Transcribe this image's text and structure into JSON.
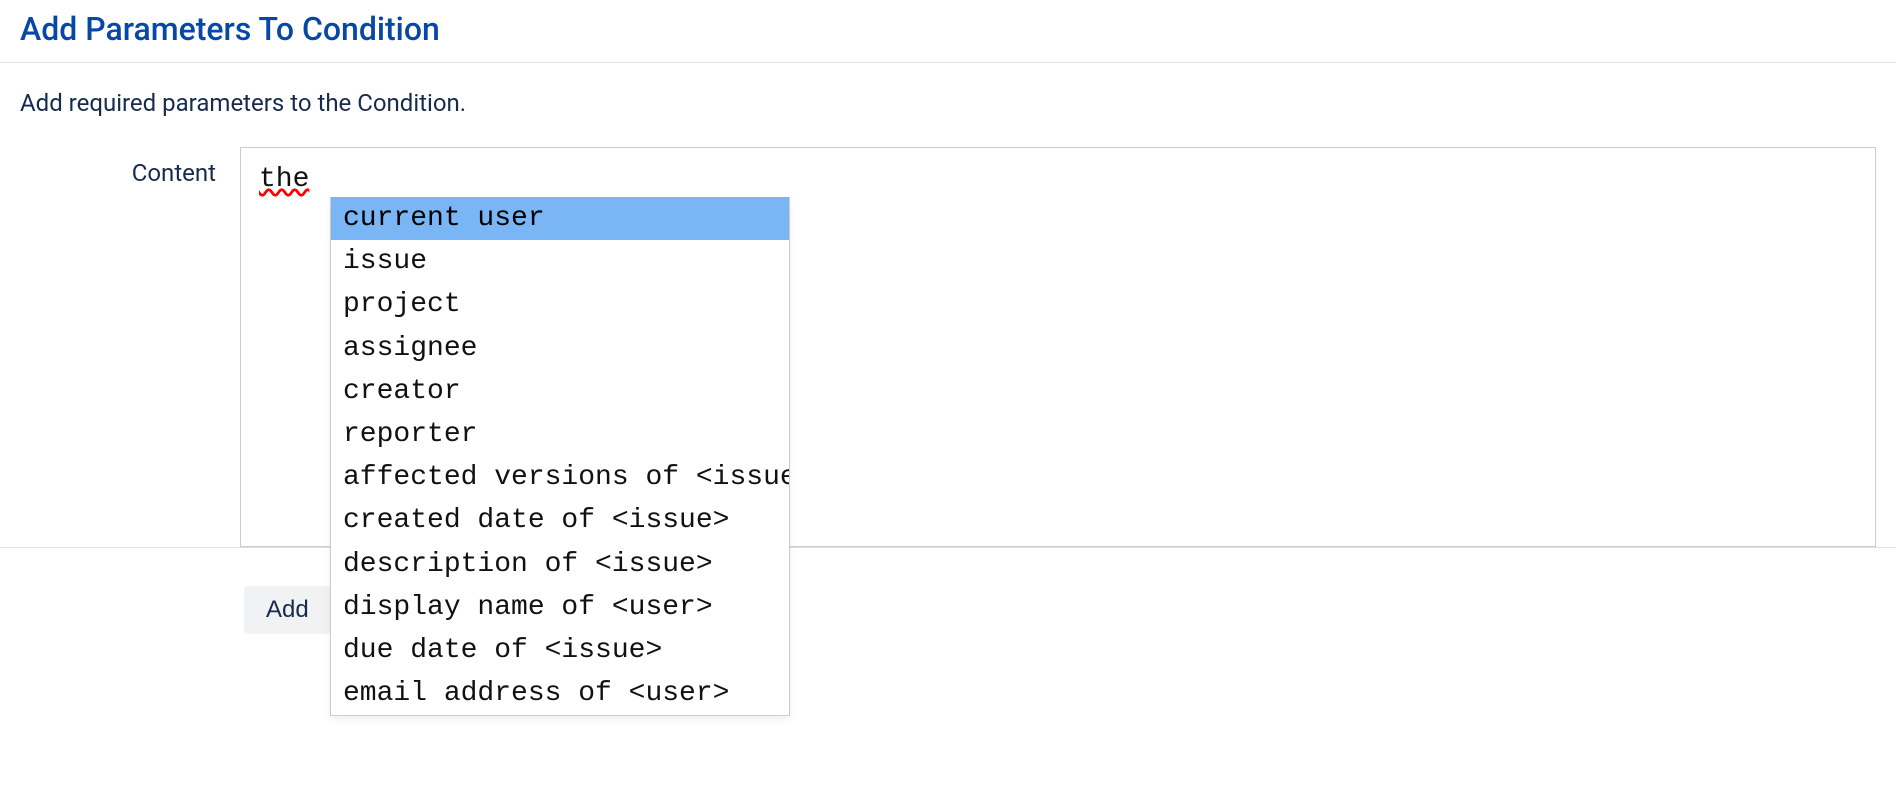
{
  "page": {
    "title": "Add Parameters To Condition",
    "description": "Add required parameters to the Condition."
  },
  "form": {
    "content_label": "Content",
    "content_value": "the",
    "add_button_label": "Add"
  },
  "autocomplete": {
    "highlighted_index": 0,
    "items": [
      "current user",
      "issue",
      "project",
      "assignee",
      "creator",
      "reporter",
      "affected versions of <issue>",
      "created date of <issue>",
      "description of <issue>",
      "display name of <user>",
      "due date of <issue>",
      "email address of <user>"
    ]
  }
}
